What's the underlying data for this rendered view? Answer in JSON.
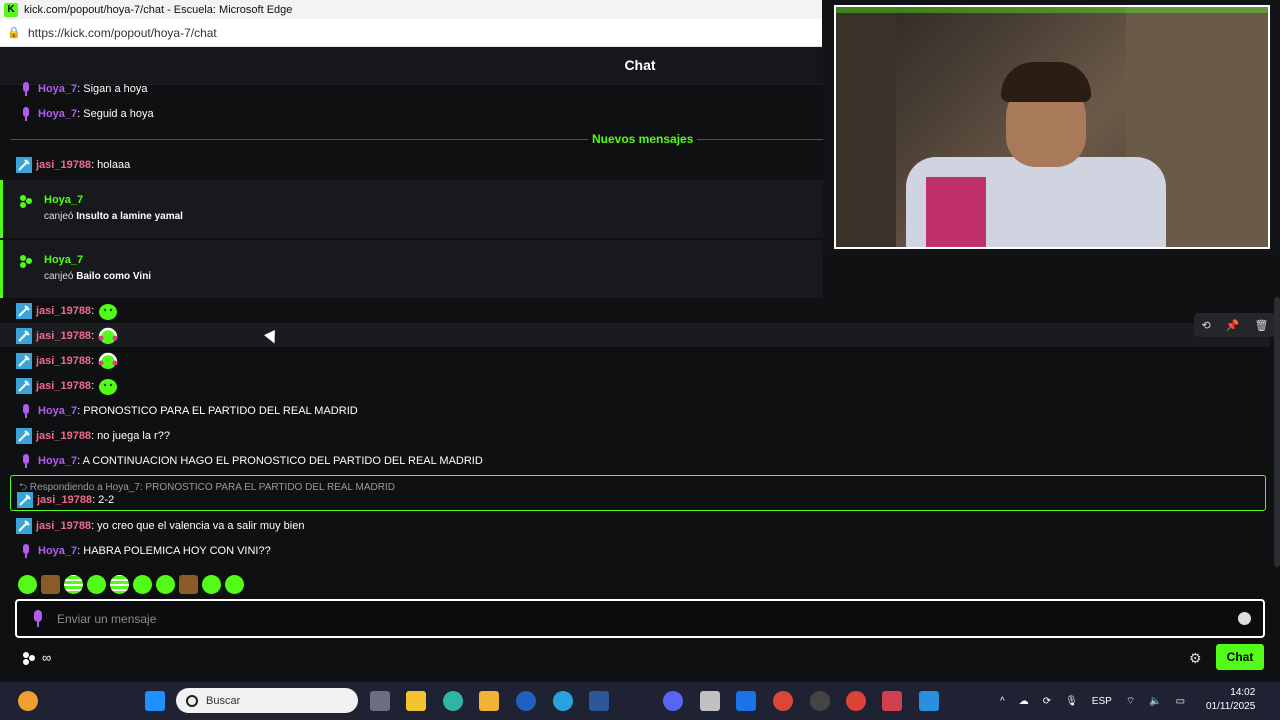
{
  "window": {
    "title": "kick.com/popout/hoya-7/chat - Escuela: Microsoft Edge",
    "url": "https://kick.com/popout/hoya-7/chat"
  },
  "chat": {
    "title": "Chat",
    "new_messages_label": "Nuevos mensajes",
    "messages_top": [
      {
        "user": "Hoya_7",
        "text": ": Sigan a hoya",
        "badge": "mic"
      },
      {
        "user": "Hoya_7",
        "text": ": Seguid a hoya",
        "badge": "mic"
      },
      {
        "user": "jasi_19788",
        "text": ": holaaa",
        "badge": "pickaxe"
      }
    ],
    "redemptions": [
      {
        "user": "Hoya_7",
        "verb": "canjeó",
        "reward": "Insulto a lamine yamal"
      },
      {
        "user": "Hoya_7",
        "verb": "canjeó",
        "reward": "Bailo como Vini"
      }
    ],
    "messages": [
      {
        "user": "jasi_19788",
        "text": ":",
        "badge": "pickaxe",
        "emote": "green-blob"
      },
      {
        "user": "jasi_19788",
        "text": ":",
        "badge": "pickaxe",
        "emote": "green-headphones"
      },
      {
        "user": "jasi_19788",
        "text": ":",
        "badge": "pickaxe",
        "emote": "green-headphones"
      },
      {
        "user": "jasi_19788",
        "text": ":",
        "badge": "pickaxe",
        "emote": "green-blob"
      },
      {
        "user": "Hoya_7",
        "text": ": PRONOSTICO PARA EL PARTIDO DEL REAL MADRID",
        "badge": "mic"
      },
      {
        "user": "jasi_19788",
        "text": ": no juega la r??",
        "badge": "pickaxe"
      },
      {
        "user": "Hoya_7",
        "text": ": A CONTINUACION HAGO EL PRONOSTICO DEL PARTIDO DEL REAL MADRID",
        "badge": "mic"
      }
    ],
    "reply": {
      "header": "Respondiendo a Hoya_7: PRONOSTICO PARA EL PARTIDO DEL REAL MADRID",
      "user": "jasi_19788",
      "text": ": 2-2"
    },
    "messages_after": [
      {
        "user": "jasi_19788",
        "text": ": yo creo que el valencia va a salir muy bien",
        "badge": "pickaxe"
      },
      {
        "user": "Hoya_7",
        "text": ": HABRA POLEMICA HOY CON VINI??",
        "badge": "mic"
      }
    ],
    "mod_tools": [
      "undo-icon",
      "pin-icon",
      "trash-icon"
    ],
    "input_placeholder": "Enviar un mensaje",
    "chat_button": "Chat",
    "bottom_glyph": "∞"
  },
  "taskbar": {
    "search_placeholder": "Buscar",
    "lang": "ESP",
    "time": "14:02",
    "date": "01/11/2025"
  },
  "colors": {
    "kick_green": "#53fc18",
    "hoya_name": "#b25bf0",
    "jasi_name": "#ef6b8a"
  }
}
